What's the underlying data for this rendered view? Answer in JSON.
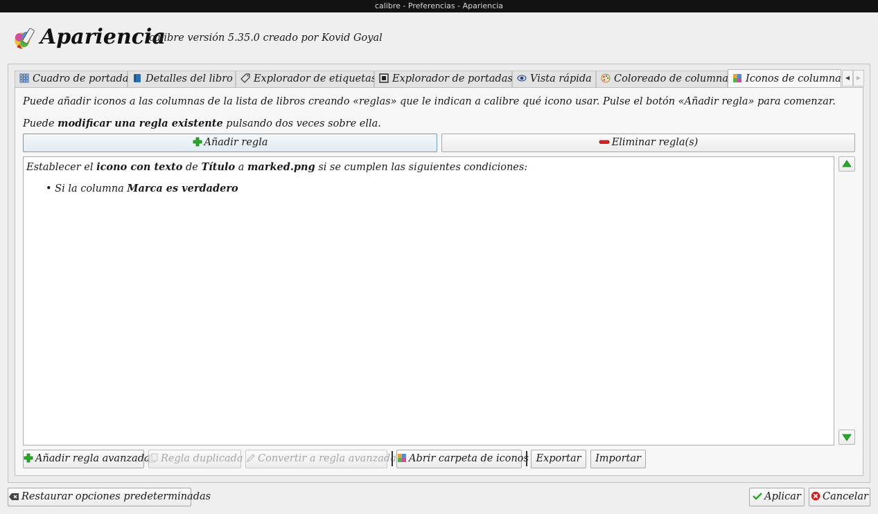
{
  "window": {
    "title": "calibre - Preferencias - Apariencia"
  },
  "header": {
    "title": "Apariencia",
    "version": "calibre versión 5.35.0 creado por Kovid Goyal"
  },
  "tabs": [
    {
      "label": "Cuadro de portadas",
      "icon": "grid-icon"
    },
    {
      "label": "Detalles del libro",
      "icon": "book-icon"
    },
    {
      "label": "Explorador de etiquetas",
      "icon": "tag-icon"
    },
    {
      "label": "Explorador de portadas",
      "icon": "cover-icon"
    },
    {
      "label": "Vista rápida",
      "icon": "eye-icon"
    },
    {
      "label": "Coloreado de columna",
      "icon": "palette-icon"
    },
    {
      "label": "Iconos de columna",
      "icon": "column-icons-icon",
      "active": true
    }
  ],
  "help": {
    "line1": "Puede añadir iconos a las columnas de la lista de libros creando «reglas» que le indican a calibre qué icono usar. Pulse el botón «Añadir regla» para comenzar.",
    "line2_prefix": "Puede ",
    "line2_bold": "modificar una regla existente",
    "line2_suffix": " pulsando dos veces sobre ella."
  },
  "buttons": {
    "add_rule": "Añadir regla",
    "remove_rules": "Eliminar regla(s)",
    "add_advanced": "Añadir regla avanzada",
    "duplicate": "Regla duplicada",
    "convert": "Convertir a regla avanzada",
    "open_folder": "Abrir carpeta de iconos",
    "export": "Exportar",
    "import": "Importar",
    "restore_defaults": "Restaurar opciones predeterminadas",
    "apply": "Aplicar",
    "cancel": "Cancelar"
  },
  "rule": {
    "t1": "Establecer el ",
    "b1": "icono con texto",
    "t2": " de ",
    "b2": "Título",
    "t3": " a ",
    "b3": "marked.png",
    "t4": " si se cumplen las siguientes condiciones:",
    "cond_t1": "Si la columna ",
    "cond_b1": "Marca es verdadero"
  },
  "colors": {
    "add_green": "#2aa82a",
    "remove_red": "#d52020",
    "focus_border": "#6f9ec5"
  }
}
